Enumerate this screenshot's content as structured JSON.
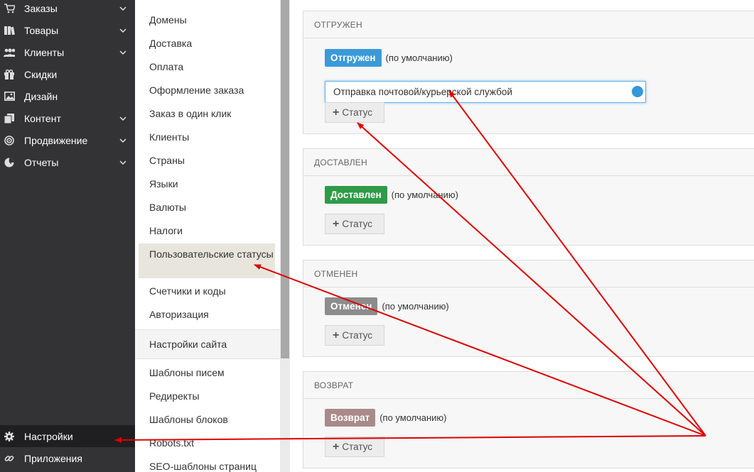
{
  "sidebar": {
    "items": [
      {
        "label": "Заказы",
        "icon": "cart-icon",
        "chevron": true
      },
      {
        "label": "Товары",
        "icon": "books-icon",
        "chevron": true
      },
      {
        "label": "Клиенты",
        "icon": "users-icon",
        "chevron": true
      },
      {
        "label": "Скидки",
        "icon": "gift-icon",
        "chevron": false
      },
      {
        "label": "Дизайн",
        "icon": "image-icon",
        "chevron": false
      },
      {
        "label": "Контент",
        "icon": "pages-icon",
        "chevron": true
      },
      {
        "label": "Продвижение",
        "icon": "target-icon",
        "chevron": true
      },
      {
        "label": "Отчеты",
        "icon": "chart-pie-icon",
        "chevron": true
      }
    ],
    "bottom": [
      {
        "label": "Настройки",
        "icon": "gear-icon",
        "active": true
      },
      {
        "label": "Приложения",
        "icon": "link-icon",
        "active": false
      }
    ]
  },
  "submenu": {
    "items": [
      "Домены",
      "Доставка",
      "Оплата",
      "Оформление заказа",
      "Заказ в один клик",
      "Клиенты",
      "Страны",
      "Языки",
      "Валюты",
      "Налоги",
      "Пользовательские статусы",
      "Счетчики и коды",
      "Авторизация"
    ],
    "active_index": 10,
    "site_settings": "Настройки сайта",
    "lower_items": [
      "Шаблоны писем",
      "Редиректы",
      "Шаблоны блоков",
      "Robots.txt",
      "SEO-шаблоны страниц"
    ]
  },
  "cards": [
    {
      "title": "ОТГРУЖЕН",
      "badge": "Отгружен",
      "badge_color": "#3a9ad9",
      "default_text": "(по умолчанию)",
      "field_value": "Отправка почтовой/курьерской службой",
      "dot_color": "#3498db",
      "add_label": "Статус"
    },
    {
      "title": "ДОСТАВЛЕН",
      "badge": "Доставлен",
      "badge_color": "#2f9b47",
      "default_text": "(по умолчанию)",
      "add_label": "Статус"
    },
    {
      "title": "ОТМЕНЕН",
      "badge": "Отменен",
      "badge_color": "#8c8c8c",
      "default_text": "(по умолчанию)",
      "add_label": "Статус"
    },
    {
      "title": "ВОЗВРАТ",
      "badge": "Возврат",
      "badge_color": "#a98a8a",
      "default_text": "(по умолчанию)",
      "add_label": "Статус"
    }
  ],
  "annotation_color": "#e00000"
}
